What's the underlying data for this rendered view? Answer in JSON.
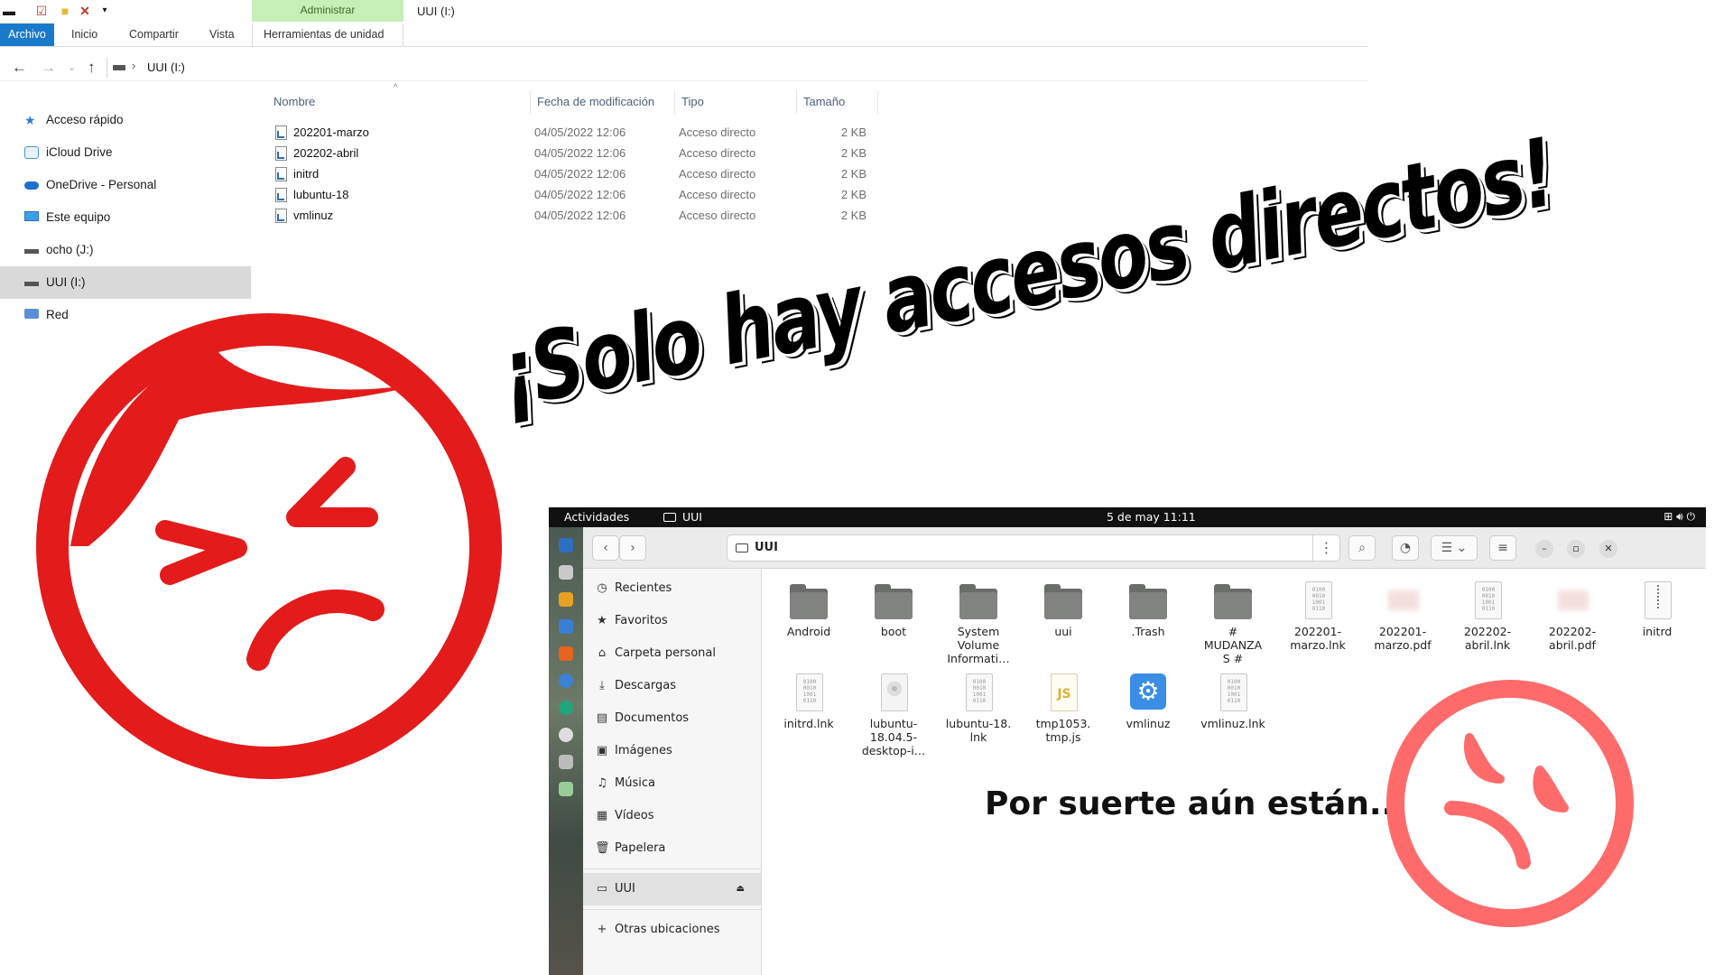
{
  "explorer": {
    "ribbon": {
      "context_tab": "Administrar",
      "window_title": "UUI (I:)",
      "tabs": [
        "Archivo",
        "Inicio",
        "Compartir",
        "Vista"
      ],
      "tool_tab": "Herramientas de unidad"
    },
    "address": {
      "path": "UUI (I:)"
    },
    "nav_pane": [
      {
        "label": "Acceso rápido",
        "icon": "star-icon"
      },
      {
        "label": "iCloud Drive",
        "icon": "cloud-icon"
      },
      {
        "label": "OneDrive - Personal",
        "icon": "onedrive-icon"
      },
      {
        "label": "Este equipo",
        "icon": "computer-icon"
      },
      {
        "label": "ocho (J:)",
        "icon": "drive-icon"
      },
      {
        "label": "UUI (I:)",
        "icon": "drive-icon",
        "selected": true
      },
      {
        "label": "Red",
        "icon": "network-icon"
      }
    ],
    "columns": [
      "Nombre",
      "Fecha de modificación",
      "Tipo",
      "Tamaño"
    ],
    "files": [
      {
        "name": "202201-marzo",
        "date": "04/05/2022 12:06",
        "type": "Acceso directo",
        "size": "2 KB"
      },
      {
        "name": "202202-abril",
        "date": "04/05/2022 12:06",
        "type": "Acceso directo",
        "size": "2 KB"
      },
      {
        "name": "initrd",
        "date": "04/05/2022 12:06",
        "type": "Acceso directo",
        "size": "2 KB"
      },
      {
        "name": "lubuntu-18",
        "date": "04/05/2022 12:06",
        "type": "Acceso directo",
        "size": "2 KB"
      },
      {
        "name": "vmlinuz",
        "date": "04/05/2022 12:06",
        "type": "Acceso directo",
        "size": "2 KB"
      }
    ]
  },
  "headline": "¡Solo hay accesos directos!",
  "ubuntu": {
    "topbar": {
      "activities": "Actividades",
      "app": "UUI",
      "clock": "5 de may  11:11"
    },
    "path": "UUI",
    "sidebar": [
      {
        "label": "Recientes",
        "icon": "clock-icon"
      },
      {
        "label": "Favoritos",
        "icon": "star-icon"
      },
      {
        "label": "Carpeta personal",
        "icon": "home-icon"
      },
      {
        "label": "Descargas",
        "icon": "download-icon"
      },
      {
        "label": "Documentos",
        "icon": "document-icon"
      },
      {
        "label": "Imágenes",
        "icon": "image-icon"
      },
      {
        "label": "Música",
        "icon": "music-icon"
      },
      {
        "label": "Vídeos",
        "icon": "video-icon"
      },
      {
        "label": "Papelera",
        "icon": "trash-icon"
      }
    ],
    "mount": {
      "label": "UUI",
      "icon": "drive-icon"
    },
    "other": {
      "label": "Otras ubicaciones",
      "icon": "plus-icon"
    },
    "items": [
      {
        "line1": "Android",
        "line2": "",
        "line3": "",
        "icon": "folder-icon"
      },
      {
        "line1": "boot",
        "line2": "",
        "line3": "",
        "icon": "folder-icon"
      },
      {
        "line1": "System",
        "line2": "Volume",
        "line3": "Informati…",
        "icon": "folder-icon"
      },
      {
        "line1": "uui",
        "line2": "",
        "line3": "",
        "icon": "folder-icon"
      },
      {
        "line1": ".Trash",
        "line2": "",
        "line3": "",
        "icon": "folder-icon"
      },
      {
        "line1": "#",
        "line2": "MUDANZA",
        "line3": "S #",
        "icon": "folder-icon"
      },
      {
        "line1": "202201-",
        "line2": "marzo.lnk",
        "line3": "",
        "icon": "binary-file-icon"
      },
      {
        "line1": "202201-",
        "line2": "marzo.pdf",
        "line3": "",
        "icon": "pdf-thumbnail-icon"
      },
      {
        "line1": "202202-",
        "line2": "abril.lnk",
        "line3": "",
        "icon": "binary-file-icon"
      },
      {
        "line1": "202202-",
        "line2": "abril.pdf",
        "line3": "",
        "icon": "pdf-thumbnail-icon"
      },
      {
        "line1": "initrd",
        "line2": "",
        "line3": "",
        "icon": "archive-file-icon"
      },
      {
        "line1": "initrd.lnk",
        "line2": "",
        "line3": "",
        "icon": "binary-file-icon"
      },
      {
        "line1": "lubuntu-",
        "line2": "18.04.5-",
        "line3": "desktop-i…",
        "icon": "disc-image-icon"
      },
      {
        "line1": "lubuntu-18.",
        "line2": "lnk",
        "line3": "",
        "icon": "binary-file-icon"
      },
      {
        "line1": "tmp1053.",
        "line2": "tmp.js",
        "line3": "",
        "icon": "javascript-file-icon"
      },
      {
        "line1": "vmlinuz",
        "line2": "",
        "line3": "",
        "icon": "executable-gear-icon"
      },
      {
        "line1": "vmlinuz.lnk",
        "line2": "",
        "line3": "",
        "icon": "binary-file-icon"
      }
    ],
    "binary_glyph": "0100 0010 1001 0110",
    "js_glyph": "JS"
  },
  "caption": "Por suerte aún están...",
  "colors": {
    "face_big": "#e31b1b",
    "face_small": "#ff6b6b",
    "win_accent": "#1979ca",
    "admin_tab": "#c6efb8"
  }
}
